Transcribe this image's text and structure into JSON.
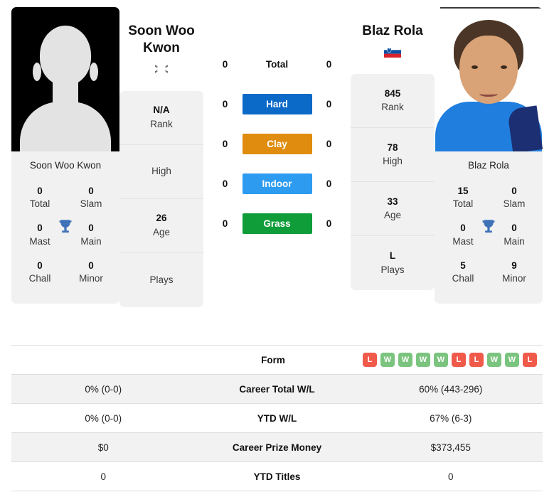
{
  "left_player": {
    "name": "Soon Woo Kwon",
    "display_name_line1": "Soon Woo",
    "display_name_line2": "Kwon",
    "flag": "south-korea-flag",
    "photo": "placeholder-avatar",
    "titles": {
      "total_value": "0",
      "total_label": "Total",
      "slam_value": "0",
      "slam_label": "Slam",
      "mast_value": "0",
      "mast_label": "Mast",
      "main_value": "0",
      "main_label": "Main",
      "chall_value": "0",
      "chall_label": "Chall",
      "minor_value": "0",
      "minor_label": "Minor"
    },
    "info": [
      {
        "value": "N/A",
        "label": "Rank"
      },
      {
        "value": "",
        "label": "High"
      },
      {
        "value": "26",
        "label": "Age"
      },
      {
        "value": "",
        "label": "Plays"
      }
    ]
  },
  "right_player": {
    "name": "Blaz Rola",
    "display_name_line1": "Blaz Rola",
    "display_name_line2": "",
    "flag": "slovenia-flag",
    "photo": "player-portrait",
    "titles": {
      "total_value": "15",
      "total_label": "Total",
      "slam_value": "0",
      "slam_label": "Slam",
      "mast_value": "0",
      "mast_label": "Mast",
      "main_value": "0",
      "main_label": "Main",
      "chall_value": "5",
      "chall_label": "Chall",
      "minor_value": "9",
      "minor_label": "Minor"
    },
    "info": [
      {
        "value": "845",
        "label": "Rank"
      },
      {
        "value": "78",
        "label": "High"
      },
      {
        "value": "33",
        "label": "Age"
      },
      {
        "value": "L",
        "label": "Plays"
      }
    ]
  },
  "surfaces": [
    {
      "label": "Total",
      "left": "0",
      "right": "0",
      "color": "transparent",
      "plain": true
    },
    {
      "label": "Hard",
      "left": "0",
      "right": "0",
      "color": "#0b69c7",
      "plain": false
    },
    {
      "label": "Clay",
      "left": "0",
      "right": "0",
      "color": "#e08c0e",
      "plain": false
    },
    {
      "label": "Indoor",
      "left": "0",
      "right": "0",
      "color": "#2d9bf0",
      "plain": false
    },
    {
      "label": "Grass",
      "left": "0",
      "right": "0",
      "color": "#0f9d3a",
      "plain": false
    }
  ],
  "stats_table": {
    "form_label": "Form",
    "form_left": "",
    "form_badges": [
      "L",
      "W",
      "W",
      "W",
      "W",
      "L",
      "L",
      "W",
      "W",
      "L"
    ],
    "rows": [
      {
        "left": "0% (0-0)",
        "label": "Career Total W/L",
        "right": "60% (443-296)"
      },
      {
        "left": "0% (0-0)",
        "label": "YTD W/L",
        "right": "67% (6-3)"
      },
      {
        "left": "$0",
        "label": "Career Prize Money",
        "right": "$373,455"
      },
      {
        "left": "0",
        "label": "YTD Titles",
        "right": "0"
      }
    ]
  },
  "colors": {
    "win_badge": "#7bc47f",
    "loss_badge": "#f05a4b",
    "trophy": "#3f72b8",
    "card_bg": "#f1f1f1"
  }
}
